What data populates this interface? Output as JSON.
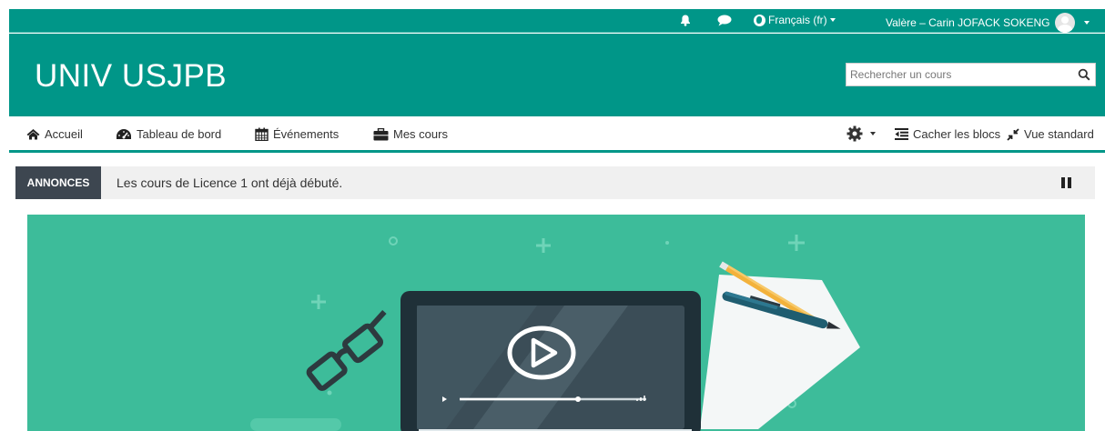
{
  "topbar": {
    "language": "Français (fr)",
    "user_name": "Valère – Carin JOFACK SOKENG"
  },
  "header": {
    "site_title": "UNIV USJPB",
    "search_placeholder": "Rechercher un cours"
  },
  "nav": {
    "items": [
      {
        "label": "Accueil",
        "icon": "home-icon"
      },
      {
        "label": "Tableau de bord",
        "icon": "dashboard-icon"
      },
      {
        "label": "Événements",
        "icon": "calendar-icon"
      },
      {
        "label": "Mes cours",
        "icon": "briefcase-icon"
      }
    ],
    "hide_blocks": "Cacher les blocs",
    "standard_view": "Vue standard"
  },
  "announcement": {
    "label": "ANNONCES",
    "text": "Les cours de Licence 1 ont déjà débuté."
  },
  "colors": {
    "brand": "#009688",
    "banner": "#3dbc9a",
    "announce_label_bg": "#3d4650"
  }
}
